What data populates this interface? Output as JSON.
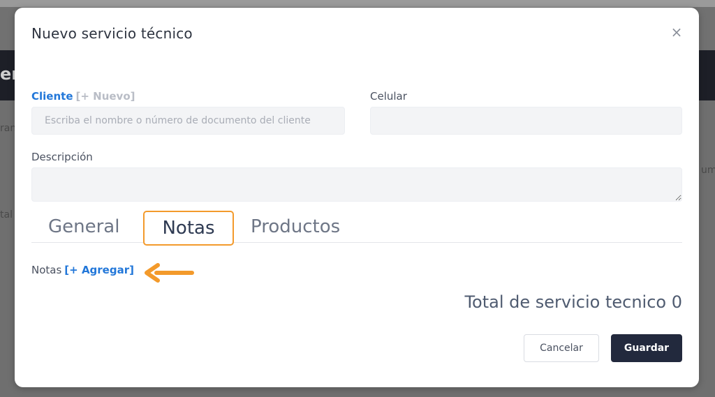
{
  "background": {
    "frag_left_big": "ery",
    "frag_left_1": "ran",
    "frag_left_2": "tal",
    "frag_right_1": "um"
  },
  "modal": {
    "title": "Nuevo servicio técnico",
    "close_symbol": "×",
    "close_icon": "close-icon"
  },
  "form": {
    "cliente_label": "Cliente",
    "cliente_new_link": "[+ Nuevo]",
    "cliente_placeholder": "Escriba el nombre o número de documento del cliente",
    "cliente_value": "",
    "celular_label": "Celular",
    "celular_value": "",
    "descripcion_label": "Descripción",
    "descripcion_value": ""
  },
  "tabs": [
    {
      "label": "General",
      "active": false
    },
    {
      "label": "Notas",
      "active": true
    },
    {
      "label": "Productos",
      "active": false
    }
  ],
  "notas": {
    "label": "Notas",
    "add_link": "[+ Agregar]",
    "arrow_icon": "arrow-left-icon",
    "arrow_color": "#f39a2b"
  },
  "total": {
    "text": "Total de servicio tecnico 0"
  },
  "buttons": {
    "cancel": "Cancelar",
    "save": "Guardar"
  },
  "colors": {
    "accent_blue": "#2277d9",
    "highlight_orange": "#f39a2b",
    "primary_dark": "#22293d"
  }
}
